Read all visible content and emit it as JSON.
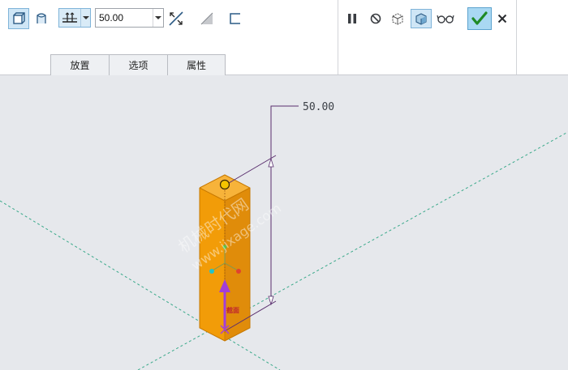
{
  "toolbar": {
    "depth_value": "50.00",
    "tabs": [
      {
        "label": "放置"
      },
      {
        "label": "选项"
      },
      {
        "label": "属性"
      }
    ],
    "icons": {
      "solid": "extrude-solid-icon",
      "surface": "extrude-surface-icon",
      "depth_type": "blind-depth-icon",
      "flip": "flip-direction-icon",
      "remove": "remove-material-icon",
      "thicken": "thicken-sketch-icon",
      "pause": "pause-icon",
      "no_preview": "no-preview-icon",
      "preview_a": "geometry-preview-icon",
      "preview_b": "feature-preview-icon",
      "verify": "verify-glasses-icon",
      "ok": "checkmark-icon",
      "cancel": "cancel-x-icon"
    }
  },
  "viewport": {
    "dimension_label": "50.00",
    "face_label": "截面",
    "watermark": "机械时代网",
    "watermark_url": "www.jixage.com",
    "colors": {
      "solid": "#f29c08",
      "solid_dark": "#d9860a",
      "solid_light": "#f7b33a",
      "axis": "#3aa98a",
      "dimension": "#5a2e6e",
      "arrow": "#a23ed9"
    }
  }
}
